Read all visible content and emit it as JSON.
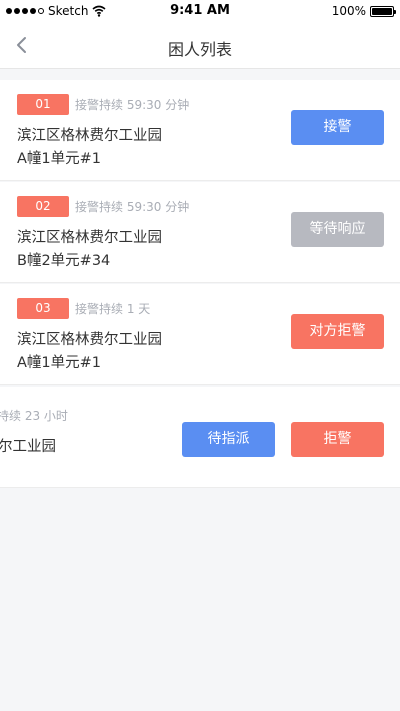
{
  "status_bar": {
    "carrier": "Sketch",
    "time": "9:41 AM",
    "battery": "100%"
  },
  "nav": {
    "title": "困人列表",
    "back_icon": "chevron-left-icon"
  },
  "colors": {
    "badge": "#f87462",
    "primary": "#5a8ef2",
    "gray": "#b7b9c0",
    "danger": "#f87462"
  },
  "cards": [
    {
      "badge": "01",
      "duration": "接警持续 59:30 分钟",
      "address_line1": "滨江区格林费尔工业园",
      "address_line2": "A幢1单元#1",
      "action_label": "接警"
    },
    {
      "badge": "02",
      "duration": "接警持续 59:30 分钟",
      "address_line1": "滨江区格林费尔工业园",
      "address_line2": "B幢2单元#34",
      "action_label": "等待响应"
    },
    {
      "badge": "03",
      "duration": "接警持续 1 天",
      "address_line1": "滨江区格林费尔工业园",
      "address_line2": "A幢1单元#1",
      "action_label": "对方拒警"
    },
    {
      "duration": "持续 23 小时",
      "address_line1": "尔工业园",
      "assign_label": "待指派",
      "reject_label": "拒警"
    }
  ]
}
